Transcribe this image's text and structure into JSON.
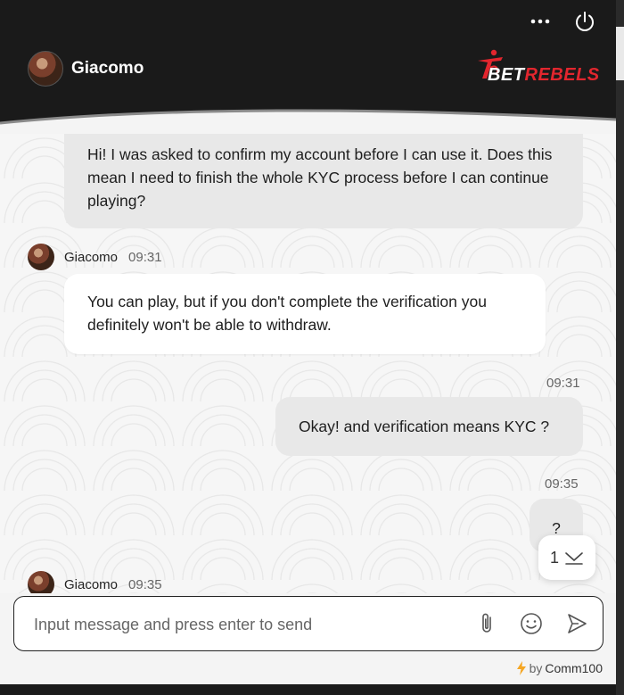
{
  "header": {
    "agent_name": "Giacomo",
    "brand_logo_white": "BET",
    "brand_logo_red": "REBELS",
    "brand_color": "#e2262e"
  },
  "messages": [
    {
      "sender": "user",
      "text": "Hi! I was asked to confirm my account before I can use it. Does this mean I need to finish the whole KYC process before I can continue playing?"
    },
    {
      "sender": "agent",
      "name": "Giacomo",
      "time": "09:31",
      "text": "You can play, but if you don't complete the verification you definitely won't be able to withdraw."
    },
    {
      "sender": "user",
      "time": "09:31",
      "text": "Okay! and verification means KYC ?"
    },
    {
      "sender": "user",
      "time": "09:35",
      "text": "?"
    },
    {
      "sender": "agent",
      "name": "Giacomo",
      "time": "09:35"
    }
  ],
  "unread": {
    "count": "1"
  },
  "composer": {
    "placeholder": "Input message and press enter to send"
  },
  "footer": {
    "by": "by",
    "vendor": "Comm100"
  }
}
